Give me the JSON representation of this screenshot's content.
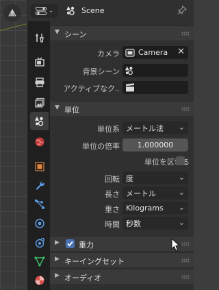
{
  "header": {
    "title": "Scene"
  },
  "panels": {
    "scene": {
      "title": "シーン",
      "camera_label": "カメラ",
      "camera_value": "Camera",
      "background_label": "背景シーン",
      "active_clip_label": "アクティブなク.."
    },
    "units": {
      "title": "単位",
      "unit_system_label": "単位系",
      "unit_system_value": "メートル法",
      "unit_scale_label": "単位の倍率",
      "unit_scale_value": "1.000000",
      "separate_units_label": "単位を区切る",
      "rotation_label": "回転",
      "rotation_value": "度",
      "length_label": "長さ",
      "length_value": "メートル",
      "mass_label": "重さ",
      "mass_value": "Kilograms",
      "time_label": "時間",
      "time_value": "秒数"
    },
    "gravity": {
      "title": "重力",
      "enabled": true
    },
    "keying_sets": {
      "title": "キーイングセット"
    },
    "audio": {
      "title": "オーディオ"
    }
  },
  "tabs": [
    "tool-tab",
    "render-tab",
    "output-tab",
    "view-layer-tab",
    "scene-tab",
    "world-tab",
    "object-tab",
    "modifiers-tab",
    "particles-tab",
    "physics-tab",
    "constraints-tab",
    "data-tab",
    "material-tab"
  ],
  "colors": {
    "accent_blue": "#4772b3",
    "panel_bg": "#303030",
    "tab_bar_bg": "#1f1f1f",
    "field_bg": "#1d1d1d"
  }
}
